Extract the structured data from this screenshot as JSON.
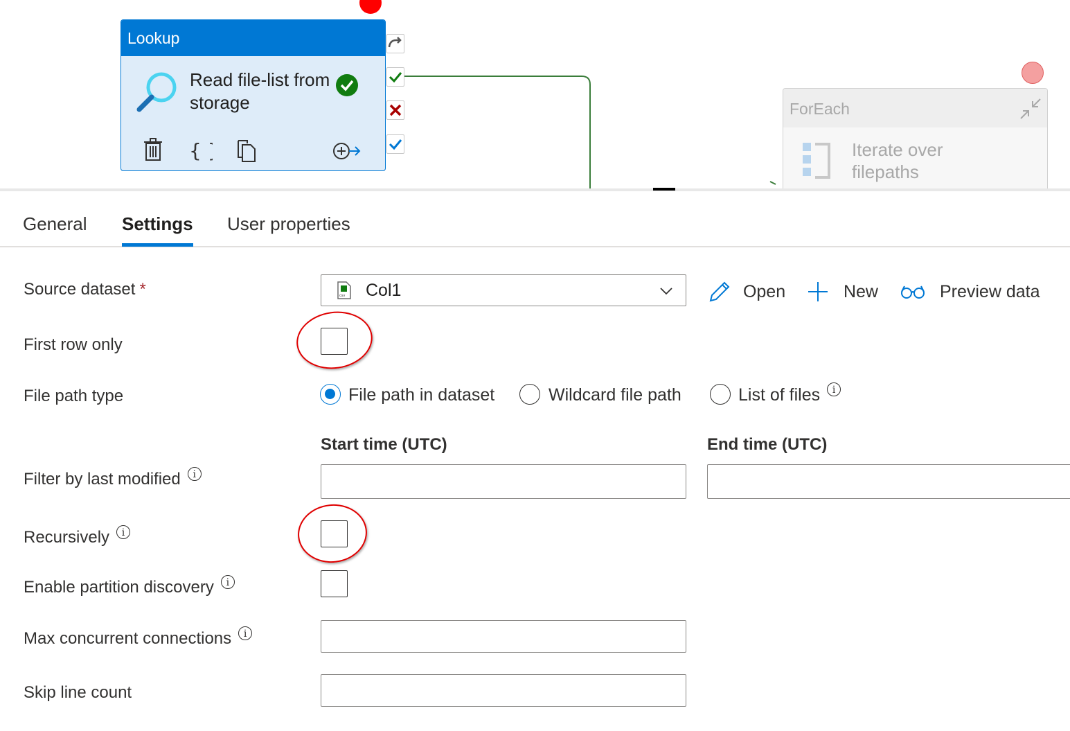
{
  "canvas": {
    "lookup_activity": {
      "type_label": "Lookup",
      "name": "Read file-list from storage",
      "status": "succeeded"
    },
    "foreach_activity": {
      "type_label": "ForEach",
      "name": "Iterate over filepaths"
    }
  },
  "tabs": [
    {
      "label": "General",
      "active": false
    },
    {
      "label": "Settings",
      "active": true
    },
    {
      "label": "User properties",
      "active": false
    }
  ],
  "settings": {
    "source_dataset": {
      "label": "Source dataset",
      "required_mark": "*",
      "value": "Col1",
      "dataset_icon": "csv-file-icon",
      "actions": {
        "open": "Open",
        "new": "New",
        "preview": "Preview data"
      }
    },
    "first_row_only": {
      "label": "First row only",
      "checked": false
    },
    "file_path_type": {
      "label": "File path type",
      "options": [
        {
          "label": "File path in dataset",
          "selected": true
        },
        {
          "label": "Wildcard file path",
          "selected": false
        },
        {
          "label": "List of files",
          "selected": false
        }
      ]
    },
    "filter_by_last_modified": {
      "label": "Filter by last modified",
      "start_label": "Start time (UTC)",
      "end_label": "End time (UTC)",
      "start_value": "",
      "end_value": ""
    },
    "recursively": {
      "label": "Recursively",
      "checked": false
    },
    "enable_partition_discovery": {
      "label": "Enable partition discovery",
      "checked": false
    },
    "max_concurrent_connections": {
      "label": "Max concurrent connections",
      "value": ""
    },
    "skip_line_count": {
      "label": "Skip line count",
      "value": ""
    }
  },
  "colors": {
    "accent": "#0078d4",
    "success": "#107c10",
    "failure": "#a80000",
    "annotation": "#e00000"
  }
}
